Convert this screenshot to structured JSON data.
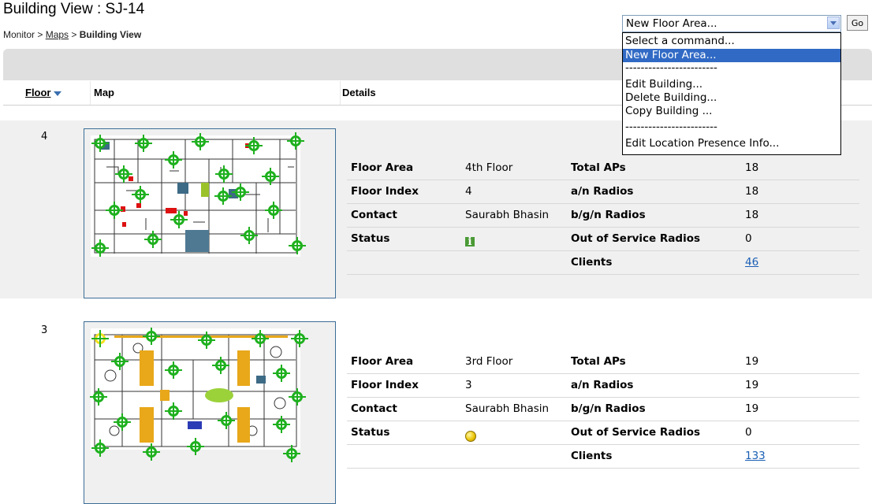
{
  "page": {
    "title": "Building View :  SJ-14",
    "breadcrumb": {
      "root": "Monitor",
      "sep1": " > ",
      "maps": "Maps",
      "sep2": " > ",
      "current": "Building View"
    }
  },
  "command": {
    "selected": "New Floor Area...",
    "go_label": "Go",
    "options": [
      "Select a command...",
      "New Floor Area...",
      "------------------------",
      "Edit Building...",
      "Delete Building...",
      "Copy Building ...",
      "------------------------",
      "Edit Location Presence Info..."
    ]
  },
  "table": {
    "col_floor": "Floor",
    "col_map": "Map",
    "col_details": "Details"
  },
  "labels": {
    "floor_area": "Floor Area",
    "floor_index": "Floor Index",
    "contact": "Contact",
    "status": "Status",
    "total_aps": "Total APs",
    "an_radios": "a/n Radios",
    "bgn_radios": "b/g/n Radios",
    "oos_radios": "Out of Service Radios",
    "clients": "Clients"
  },
  "floors": [
    {
      "number": "4",
      "floor_area": "4th Floor",
      "floor_index": "4",
      "contact": "Saurabh Bhasin",
      "status_icon": "info-icon",
      "total_aps": "18",
      "an_radios": "18",
      "bgn_radios": "18",
      "oos_radios": "0",
      "clients": "46"
    },
    {
      "number": "3",
      "floor_area": "3rd Floor",
      "floor_index": "3",
      "contact": "Saurabh Bhasin",
      "status_icon": "yellow-status-icon",
      "total_aps": "19",
      "an_radios": "19",
      "bgn_radios": "19",
      "oos_radios": "0",
      "clients": "133"
    }
  ],
  "colors": {
    "accent": "#316ac5",
    "ap_marker": "#1eb01e",
    "link": "#1a5fb4"
  }
}
